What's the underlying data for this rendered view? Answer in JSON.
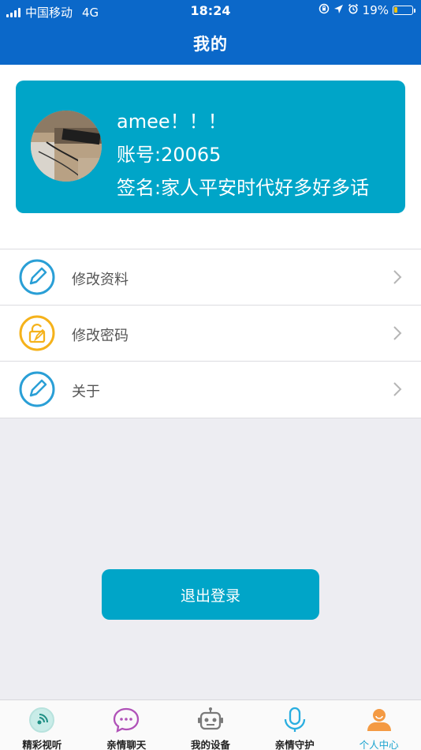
{
  "status_bar": {
    "carrier": "中国移动",
    "network": "4G",
    "time": "18:24",
    "battery_percent": "19%",
    "battery_level": 0.19
  },
  "header": {
    "title": "我的"
  },
  "profile": {
    "name": "amee！！！",
    "account": "账号:20065",
    "signature": "签名:家人平安时代好多好多话"
  },
  "menu": [
    {
      "label": "修改资料",
      "icon": "edit-pencil-icon",
      "color": "#2a9fd6"
    },
    {
      "label": "修改密码",
      "icon": "lock-edit-icon",
      "color": "#f5b21b"
    },
    {
      "label": "关于",
      "icon": "edit-pencil-icon",
      "color": "#2a9fd6"
    }
  ],
  "logout_label": "退出登录",
  "tabs": [
    {
      "label": "精彩视听",
      "icon": "broadcast-icon",
      "active": false
    },
    {
      "label": "亲情聊天",
      "icon": "chat-bubble-icon",
      "active": false
    },
    {
      "label": "我的设备",
      "icon": "robot-icon",
      "active": false
    },
    {
      "label": "亲情守护",
      "icon": "microphone-icon",
      "active": false
    },
    {
      "label": "个人中心",
      "icon": "person-icon",
      "active": true
    }
  ],
  "colors": {
    "header": "#0b68c9",
    "card": "#00a5c8",
    "accent": "#1aa3cf",
    "lock_icon": "#f5b21b"
  }
}
